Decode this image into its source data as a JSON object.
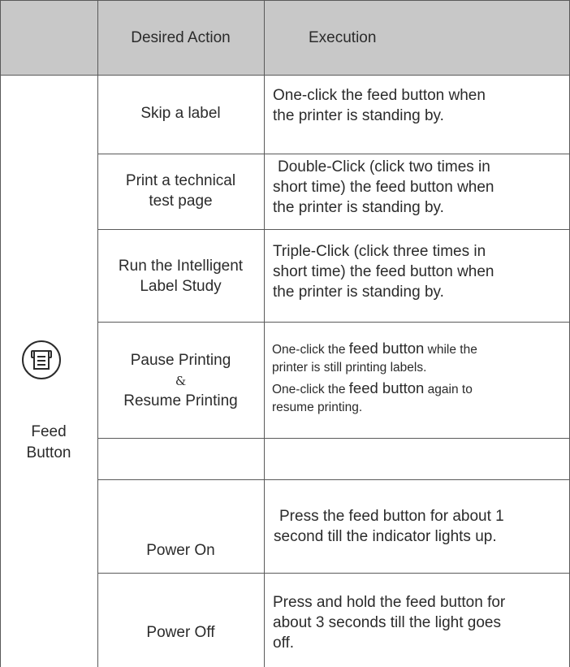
{
  "header": {
    "col_action": "Desired Action",
    "col_execution": "Execution"
  },
  "feature": {
    "icon": "printer-feed-icon",
    "label_line1": "Feed",
    "label_line2": "Button"
  },
  "rows": [
    {
      "action": [
        "Skip a label"
      ],
      "execution": [
        "One-click the feed button when",
        "the printer is standing by."
      ]
    },
    {
      "action": [
        "Print a technical",
        "test page"
      ],
      "execution": [
        "Double-Click  (click two times in",
        "short time) the feed button when",
        "the printer is standing by."
      ]
    },
    {
      "action": [
        "Run the Intelligent",
        "Label Study"
      ],
      "execution": [
        "Triple-Click (click three times in",
        "short time) the feed button when",
        "the printer is standing by."
      ]
    },
    {
      "action": [
        "Pause Printing",
        "&",
        "Resume Printing"
      ],
      "execution": [
        {
          "pre": "One-click the ",
          "em": "feed button",
          "post": " while the"
        },
        {
          "pre": "printer is still printing labels.",
          "em": "",
          "post": ""
        },
        {
          "pre": "One-click the ",
          "em": "feed button",
          "post": " again to"
        },
        {
          "pre": "resume printing.",
          "em": "",
          "post": ""
        }
      ]
    },
    {
      "action": [
        "Power On"
      ],
      "execution": [
        "Press the feed button for about 1",
        "second till the indicator lights up."
      ]
    },
    {
      "action": [
        "Power Off"
      ],
      "execution": [
        "Press and hold the feed button for",
        "about 3 seconds till the light goes",
        "off."
      ]
    }
  ],
  "colors": {
    "header_bg": "#c8c8c8",
    "grid": "#5a5a5a",
    "text": "#2b2b2b"
  }
}
